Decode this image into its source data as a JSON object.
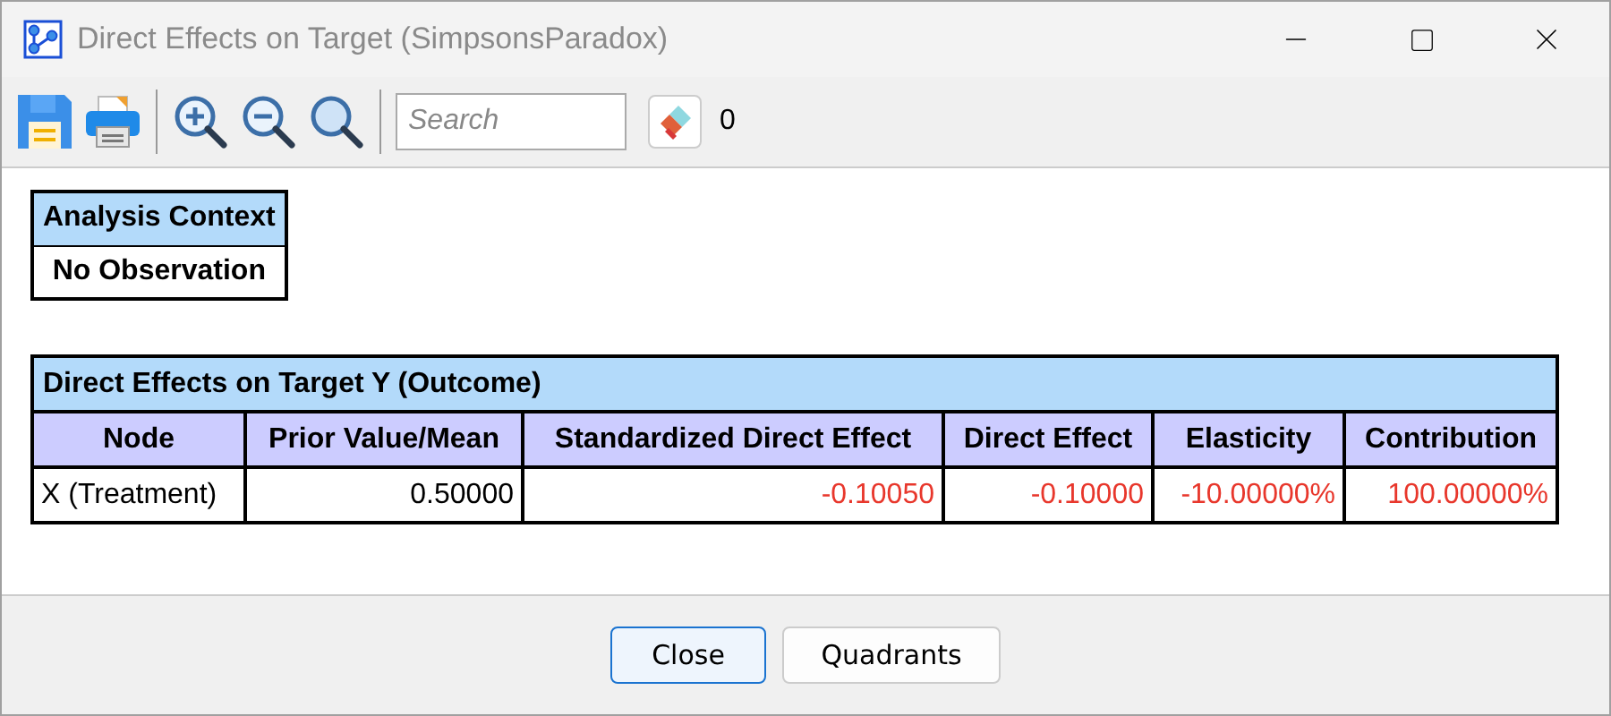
{
  "window": {
    "title": "Direct Effects on Target (SimpsonsParadox)"
  },
  "toolbar": {
    "search": {
      "placeholder": "Search"
    },
    "count": "0"
  },
  "context_table": {
    "title": "Analysis Context",
    "value": "No Observation"
  },
  "effects_table": {
    "title": "Direct Effects on Target Y (Outcome)",
    "columns": [
      "Node",
      "Prior Value/Mean",
      "Standardized Direct Effect",
      "Direct Effect",
      "Elasticity",
      "Contribution"
    ],
    "rows": [
      [
        {
          "text": "X (Treatment)",
          "color": "#000000"
        },
        {
          "text": "0.50000",
          "color": "#000000"
        },
        {
          "text": "-0.10050",
          "color": "#e8372c"
        },
        {
          "text": "-0.10000",
          "color": "#e8372c"
        },
        {
          "text": "-10.00000%",
          "color": "#e8372c"
        },
        {
          "text": "100.00000%",
          "color": "#e8372c"
        }
      ]
    ]
  },
  "buttons": [
    {
      "label": "Close",
      "default": true
    },
    {
      "label": "Quadrants",
      "default": false
    }
  ]
}
